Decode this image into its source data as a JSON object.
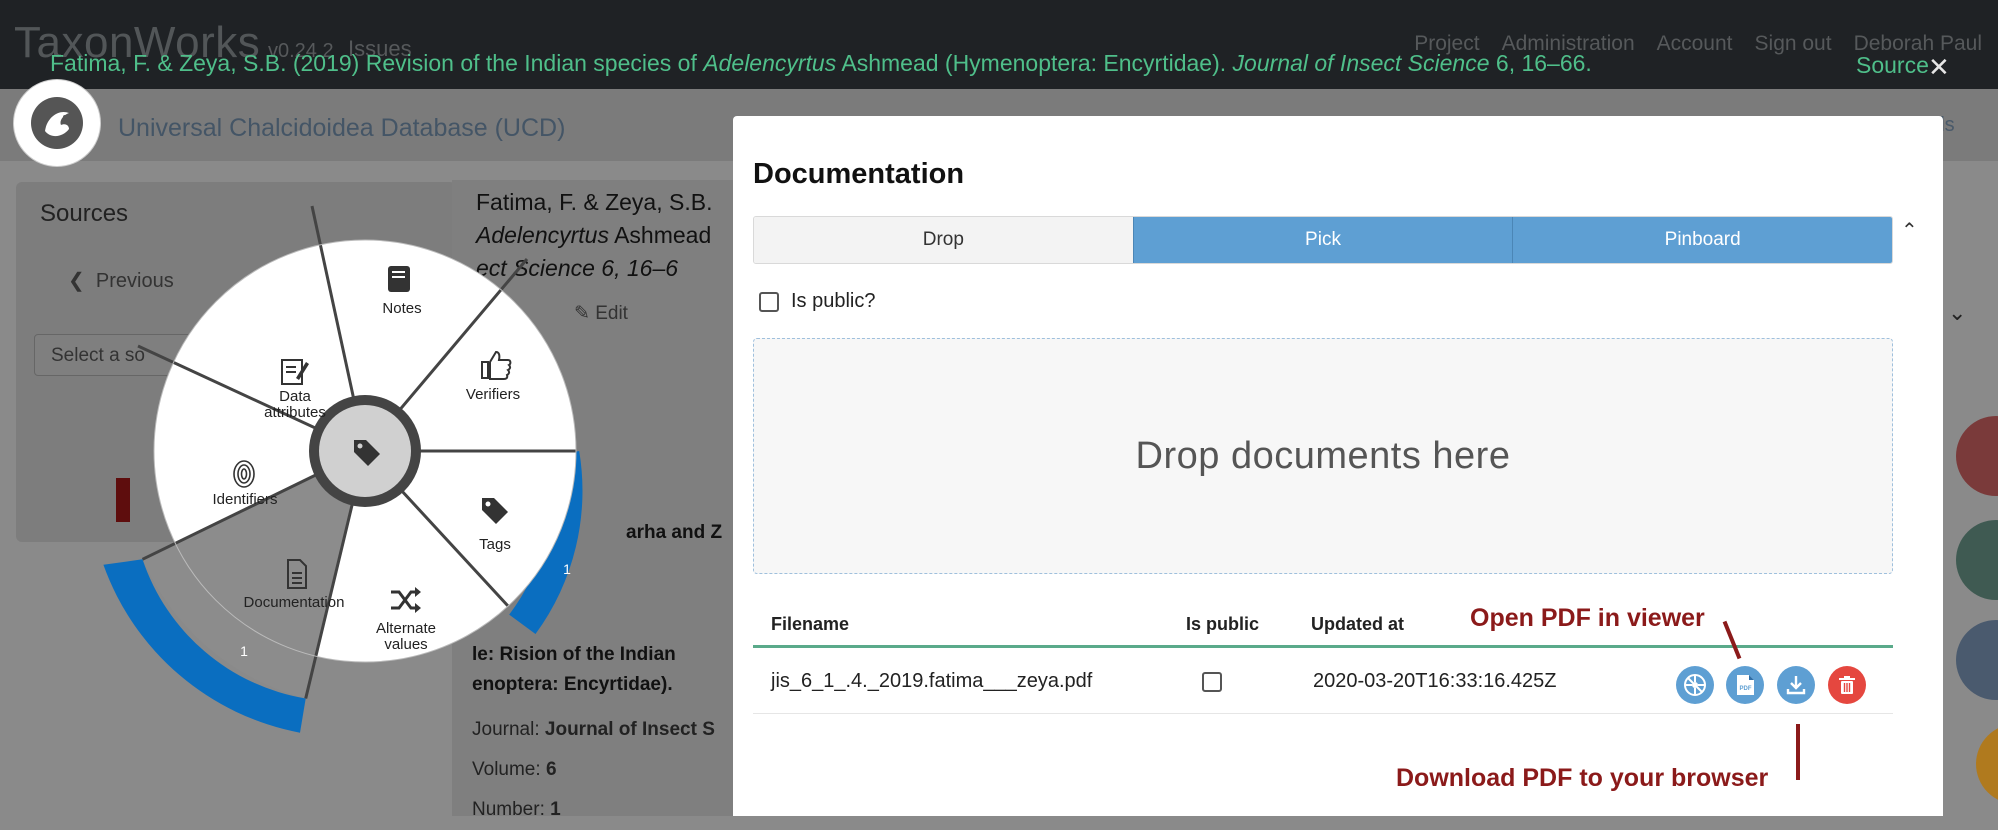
{
  "topbar": {
    "brand": "TaxonWorks",
    "version": "v0.24.2",
    "issues": "Issues",
    "nav": [
      "Project",
      "Administration",
      "Account",
      "Sign out",
      "Deborah Paul"
    ]
  },
  "subbar": {
    "project_name": "Universal Chalcidoidea Database (UCD)",
    "tutorials_fragment": "rials"
  },
  "banner": {
    "citation_pre": "Fatima, F. & Zeya, S.B. (2019) Revision of the Indian species of ",
    "citation_genus": "Adelencyrtus",
    "citation_mid": " Ashmead (Hymenoptera: Encyrtidae). ",
    "citation_journal": "Journal of Insect Science",
    "citation_post": " 6, 16–66.",
    "object_type": "Source",
    "close": "✕"
  },
  "sources_panel": {
    "title": "Sources",
    "previous": "Previous",
    "select_placeholder": "Select a so"
  },
  "main_panel": {
    "title_line1": "Fatima, F. & Zeya, S.B.",
    "title_genus": "Adelencyrtus",
    "title_line2_rest": " Ashmead",
    "title_line3": "ect Science 6, 16–6",
    "edit": "Edit",
    "author_fragment": "arha and Z",
    "title_fragment_1": "le: R",
    "title_fragment_2": "ision of the Indian",
    "title_fragment_3": "enoptera: Encyrtidae).",
    "journal_label": "Journal:",
    "journal_value": "Journal of Insect S",
    "volume_label": "Volume:",
    "volume_value": "6",
    "number_label": "Number:",
    "number_value": "1"
  },
  "radial": {
    "segments": [
      {
        "label": "Notes",
        "icon": "book-icon"
      },
      {
        "label": "Verifiers",
        "icon": "thumbs-up-icon"
      },
      {
        "label": "Tags",
        "icon": "tag-icon",
        "count": "1"
      },
      {
        "label": "Alternate values",
        "icon": "shuffle-icon"
      },
      {
        "label": "Documentation",
        "icon": "document-icon",
        "count": "1",
        "selected": true
      },
      {
        "label": "Identifiers",
        "icon": "fingerprint-icon"
      },
      {
        "label": "Data attributes",
        "icon": "data-attributes-icon"
      }
    ],
    "center_icon": "tag-icon",
    "colors": {
      "ring": "#0a6ec0",
      "selected": "#8c8c8c",
      "center": "#d0d0d0"
    }
  },
  "modal": {
    "title": "Documentation",
    "tabs": [
      "Drop",
      "Pick",
      "Pinboard"
    ],
    "active_tab": "Drop",
    "is_public_label": "Is public?",
    "dropzone_text": "Drop documents here",
    "table": {
      "headers": [
        "Filename",
        "Is public",
        "Updated at"
      ],
      "rows": [
        {
          "filename": "jis_6_1_.4._2019.fatima___zeya.pdf",
          "is_public": false,
          "updated_at": "2020-03-20T16:33:16.425Z"
        }
      ]
    },
    "actions": [
      {
        "name": "radial-action-button",
        "icon": "radial-menu-icon",
        "color": "#5e9fd3"
      },
      {
        "name": "open-pdf-viewer-button",
        "icon": "pdf-icon",
        "color": "#5e9fd3"
      },
      {
        "name": "download-button",
        "icon": "download-icon",
        "color": "#5e9fd3"
      },
      {
        "name": "delete-button",
        "icon": "trash-icon",
        "color": "#e5473f"
      }
    ]
  },
  "annotations": {
    "open_pdf": "Open PDF in viewer",
    "download_pdf": "Download PDF to your browser"
  }
}
